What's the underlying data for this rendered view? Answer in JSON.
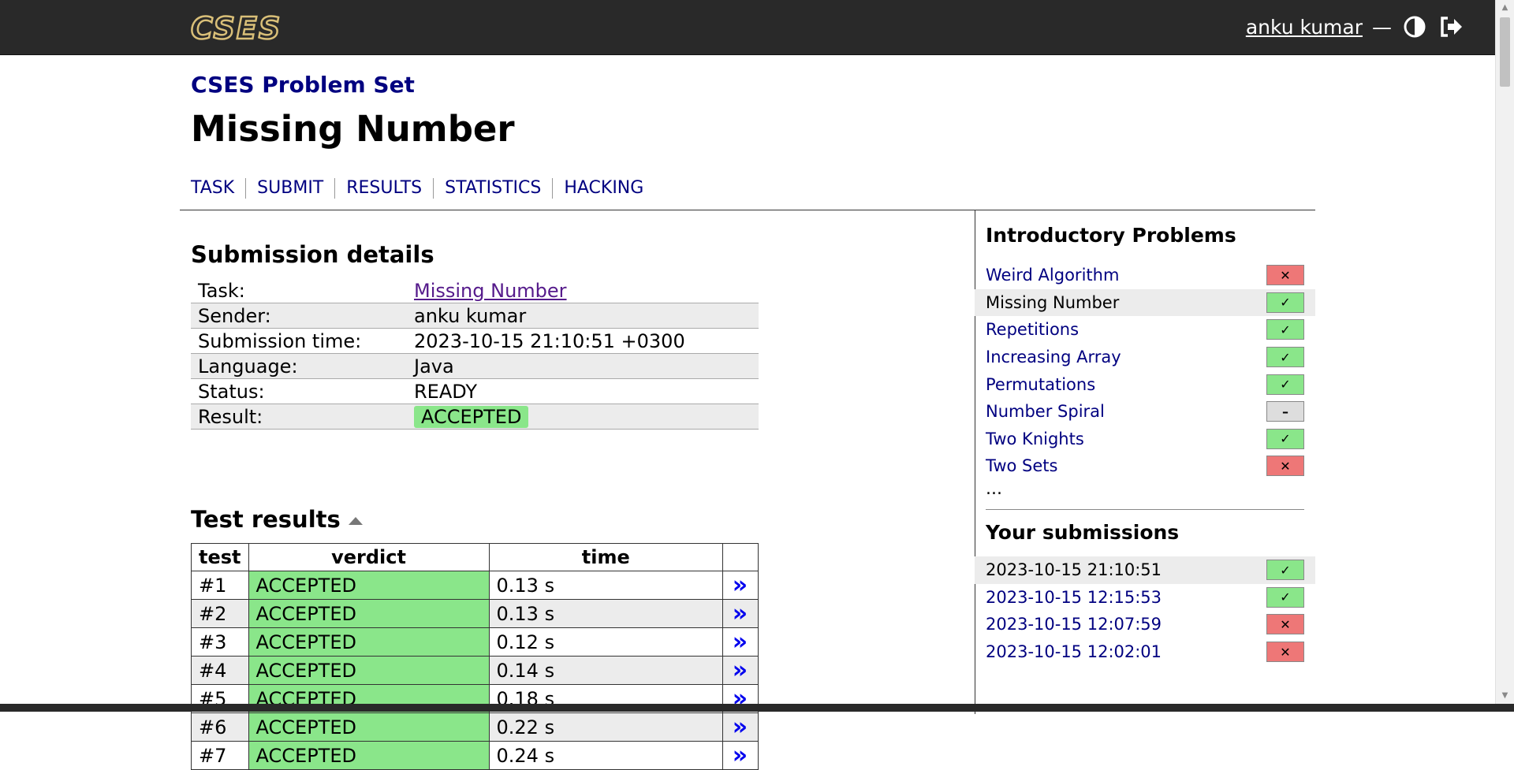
{
  "header": {
    "logo_text": "CSES",
    "user_name": "anku kumar",
    "separator": "—",
    "theme_icon": "contrast-icon",
    "logout_icon": "logout-icon"
  },
  "page": {
    "subtitle": "CSES Problem Set",
    "title": "Missing Number",
    "tabs": [
      "TASK",
      "SUBMIT",
      "RESULTS",
      "STATISTICS",
      "HACKING"
    ]
  },
  "submission": {
    "heading": "Submission details",
    "rows": [
      {
        "key": "Task:",
        "value": "Missing Number"
      },
      {
        "key": "Sender:",
        "value": "anku kumar"
      },
      {
        "key": "Submission time:",
        "value": "2023-10-15 21:10:51 +0300"
      },
      {
        "key": "Language:",
        "value": "Java"
      },
      {
        "key": "Status:",
        "value": "READY"
      },
      {
        "key": "Result:",
        "value": "ACCEPTED"
      }
    ]
  },
  "tests": {
    "heading": "Test results",
    "columns": [
      "test",
      "verdict",
      "time"
    ],
    "go_symbol": "»",
    "rows": [
      {
        "test": "#1",
        "verdict": "ACCEPTED",
        "time": "0.13 s"
      },
      {
        "test": "#2",
        "verdict": "ACCEPTED",
        "time": "0.13 s"
      },
      {
        "test": "#3",
        "verdict": "ACCEPTED",
        "time": "0.12 s"
      },
      {
        "test": "#4",
        "verdict": "ACCEPTED",
        "time": "0.14 s"
      },
      {
        "test": "#5",
        "verdict": "ACCEPTED",
        "time": "0.18 s"
      },
      {
        "test": "#6",
        "verdict": "ACCEPTED",
        "time": "0.22 s"
      },
      {
        "test": "#7",
        "verdict": "ACCEPTED",
        "time": "0.24 s"
      }
    ]
  },
  "sidebar": {
    "problems_heading": "Introductory Problems",
    "problems": [
      {
        "name": "Weird Algorithm",
        "status": "bad",
        "current": false
      },
      {
        "name": "Missing Number",
        "status": "ok",
        "current": true
      },
      {
        "name": "Repetitions",
        "status": "ok",
        "current": false
      },
      {
        "name": "Increasing Array",
        "status": "ok",
        "current": false
      },
      {
        "name": "Permutations",
        "status": "ok",
        "current": false
      },
      {
        "name": "Number Spiral",
        "status": "none",
        "current": false
      },
      {
        "name": "Two Knights",
        "status": "ok",
        "current": false
      },
      {
        "name": "Two Sets",
        "status": "bad",
        "current": false
      }
    ],
    "more": "...",
    "submissions_heading": "Your submissions",
    "submissions": [
      {
        "time": "2023-10-15 21:10:51",
        "status": "ok",
        "current": true
      },
      {
        "time": "2023-10-15 12:15:53",
        "status": "ok",
        "current": false
      },
      {
        "time": "2023-10-15 12:07:59",
        "status": "bad",
        "current": false
      },
      {
        "time": "2023-10-15 12:02:01",
        "status": "bad",
        "current": false
      }
    ]
  },
  "colors": {
    "topbar": "#292929",
    "link": "#000080",
    "accepted": "#8ae68a",
    "rejected": "#ee7777"
  }
}
